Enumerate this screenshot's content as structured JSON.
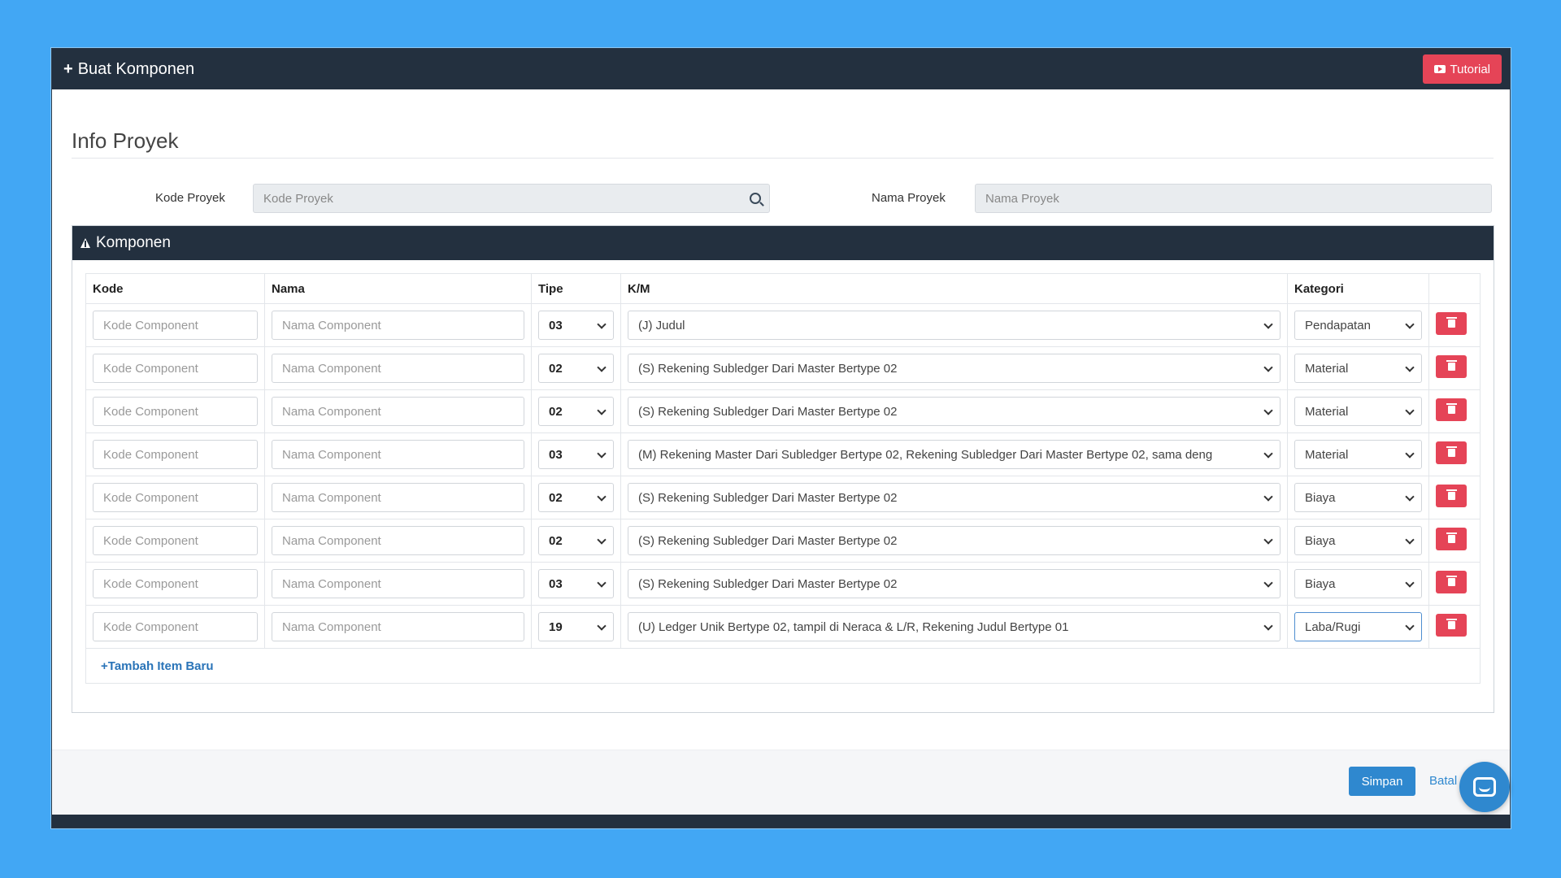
{
  "header": {
    "title": "Buat Komponen",
    "tutorial_label": "Tutorial"
  },
  "info": {
    "section_title": "Info Proyek",
    "kode_label": "Kode Proyek",
    "kode_placeholder": "Kode Proyek",
    "nama_label": "Nama Proyek",
    "nama_placeholder": "Nama Proyek"
  },
  "komponen": {
    "title": "Komponen",
    "columns": [
      "Kode",
      "Nama",
      "Tipe",
      "K/M",
      "Kategori",
      ""
    ],
    "kode_placeholder": "Kode Component",
    "nama_placeholder": "Nama Component",
    "rows": [
      {
        "tipe": "03",
        "km": "(J) Judul",
        "kategori": "Pendapatan"
      },
      {
        "tipe": "02",
        "km": "(S) Rekening Subledger Dari Master Bertype 02",
        "kategori": "Material"
      },
      {
        "tipe": "02",
        "km": "(S) Rekening Subledger Dari Master Bertype 02",
        "kategori": "Material"
      },
      {
        "tipe": "03",
        "km": "(M) Rekening Master Dari Subledger Bertype 02, Rekening Subledger Dari Master Bertype 02, sama deng",
        "kategori": "Material"
      },
      {
        "tipe": "02",
        "km": "(S) Rekening Subledger Dari Master Bertype 02",
        "kategori": "Biaya"
      },
      {
        "tipe": "02",
        "km": "(S) Rekening Subledger Dari Master Bertype 02",
        "kategori": "Biaya"
      },
      {
        "tipe": "03",
        "km": "(S) Rekening Subledger Dari Master Bertype 02",
        "kategori": "Biaya"
      },
      {
        "tipe": "19",
        "km": "(U) Ledger Unik Bertype 02, tampil di Neraca & L/R, Rekening Judul Bertype 01",
        "kategori": "Laba/Rugi"
      }
    ],
    "add_label": "Tambah Item Baru"
  },
  "footer": {
    "simpan_label": "Simpan",
    "batal_label": "Batal"
  },
  "colors": {
    "header_bg": "#23303f",
    "danger": "#e54457",
    "primary": "#2f88cf",
    "page_bg": "#42a7f4"
  }
}
